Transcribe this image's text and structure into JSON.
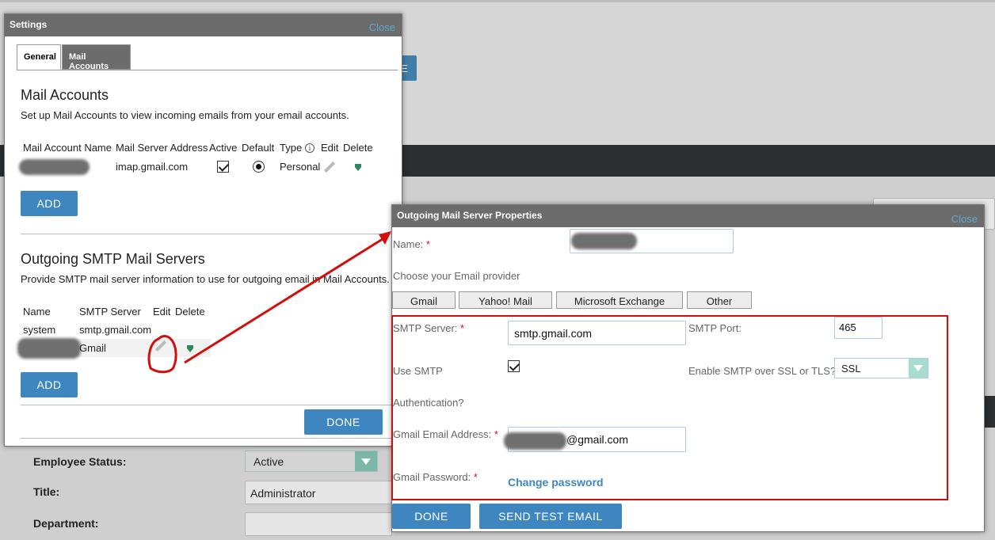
{
  "background": {
    "employee_status_label": "Employee Status:",
    "employee_status_value": "Active",
    "title_label": "Title:",
    "title_value": "Administrator",
    "department_label": "Department:"
  },
  "settings": {
    "title": "Settings",
    "close": "Close",
    "tabs": [
      "General",
      "Mail Accounts"
    ],
    "active_tab": "Mail Accounts",
    "mail_accounts": {
      "heading": "Mail Accounts",
      "description": "Set up Mail Accounts to view incoming emails from your email accounts.",
      "columns": [
        "Mail Account Name",
        "Mail Server Address",
        "Active",
        "Default",
        "Type",
        "Edit",
        "Delete"
      ],
      "rows": [
        {
          "server": "imap.gmail.com",
          "active": true,
          "default": true,
          "type": "Personal"
        }
      ],
      "add": "ADD"
    },
    "smtp": {
      "heading": "Outgoing SMTP Mail Servers",
      "description": "Provide SMTP mail server information to use for outgoing email in Mail Accounts.",
      "columns": [
        "Name",
        "SMTP Server",
        "Edit",
        "Delete"
      ],
      "rows": [
        {
          "name": "system",
          "server": "smtp.gmail.com"
        },
        {
          "server": "Gmail"
        }
      ],
      "add": "ADD"
    },
    "done": "DONE"
  },
  "outgoing": {
    "title": "Outgoing Mail Server Properties",
    "close": "Close",
    "name_label": "Name:",
    "provider_label": "Choose your Email provider",
    "providers": [
      "Gmail",
      "Yahoo! Mail",
      "Microsoft Exchange",
      "Other"
    ],
    "smtp_server_label": "SMTP Server:",
    "smtp_server_value": "smtp.gmail.com",
    "smtp_port_label": "SMTP Port:",
    "smtp_port_value": "465",
    "use_smtp_label": "Use SMTP",
    "auth_label": "Authentication?",
    "use_smtp_checked": true,
    "ssl_label": "Enable SMTP over SSL or TLS?",
    "ssl_value": "SSL",
    "email_label": "Gmail Email Address:",
    "email_value": "@gmail.com",
    "password_label": "Gmail Password:",
    "change_password": "Change password",
    "done": "DONE",
    "send_test": "SEND TEST EMAIL",
    "required_mark": "*"
  },
  "colors": {
    "accent_blue": "#3d86c0",
    "dialog_header": "#6c6c6c",
    "highlight_red": "#d40d0d",
    "close_link": "#5aa7d4"
  }
}
